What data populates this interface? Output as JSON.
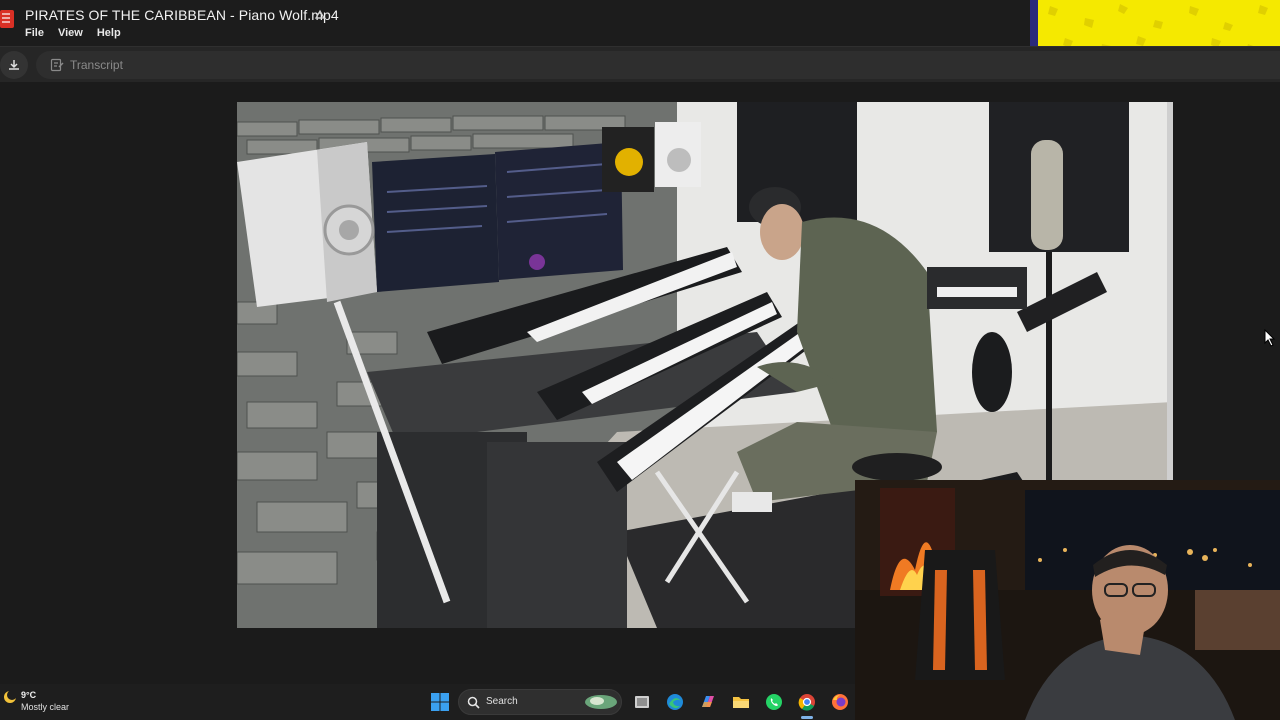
{
  "window": {
    "title": "PIRATES OF THE CARIBBEAN - Piano Wolf.mp4",
    "menu": [
      "File",
      "View",
      "Help"
    ]
  },
  "toolbar": {
    "download_icon": "download-icon",
    "transcript_label": "Transcript"
  },
  "taskbar": {
    "weather": {
      "temp": "9°C",
      "desc": "Mostly clear",
      "icon": "weather-moon-icon"
    },
    "search_label": "Search",
    "apps": [
      "windows-start-icon",
      "search-icon",
      "task-view-icon",
      "edge-icon",
      "copilot-icon",
      "file-explorer-icon",
      "whatsapp-icon",
      "chrome-icon",
      "firefox-icon"
    ]
  },
  "colors": {
    "accent_yellow": "#f5e900",
    "menu_bg": "#1c1c1c",
    "toolbar_bg": "#262626"
  }
}
